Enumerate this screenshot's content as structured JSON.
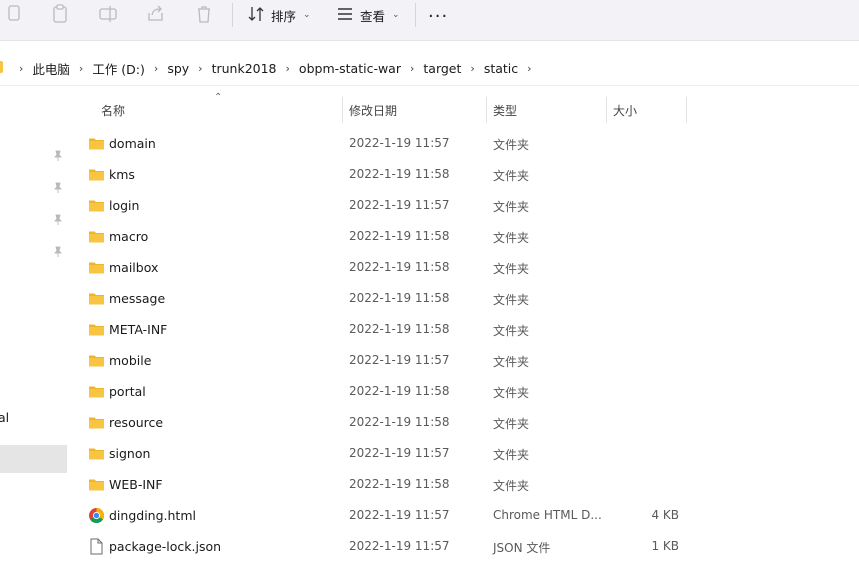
{
  "toolbar": {
    "sort_label": "排序",
    "view_label": "查看",
    "more_label": "···"
  },
  "breadcrumb": [
    "此电脑",
    "工作 (D:)",
    "spy",
    "trunk2018",
    "obpm-static-war",
    "target",
    "static"
  ],
  "sidebar": {
    "partial_label": "al"
  },
  "columns": {
    "name": "名称",
    "date": "修改日期",
    "type": "类型",
    "size": "大小"
  },
  "files": [
    {
      "name": "domain",
      "date": "2022-1-19 11:57",
      "type": "文件夹",
      "size": "",
      "icon": "folder-icon"
    },
    {
      "name": "kms",
      "date": "2022-1-19 11:58",
      "type": "文件夹",
      "size": "",
      "icon": "folder-icon"
    },
    {
      "name": "login",
      "date": "2022-1-19 11:57",
      "type": "文件夹",
      "size": "",
      "icon": "folder-icon"
    },
    {
      "name": "macro",
      "date": "2022-1-19 11:58",
      "type": "文件夹",
      "size": "",
      "icon": "folder-icon"
    },
    {
      "name": "mailbox",
      "date": "2022-1-19 11:58",
      "type": "文件夹",
      "size": "",
      "icon": "folder-icon"
    },
    {
      "name": "message",
      "date": "2022-1-19 11:58",
      "type": "文件夹",
      "size": "",
      "icon": "folder-icon"
    },
    {
      "name": "META-INF",
      "date": "2022-1-19 11:58",
      "type": "文件夹",
      "size": "",
      "icon": "folder-icon"
    },
    {
      "name": "mobile",
      "date": "2022-1-19 11:57",
      "type": "文件夹",
      "size": "",
      "icon": "folder-icon"
    },
    {
      "name": "portal",
      "date": "2022-1-19 11:58",
      "type": "文件夹",
      "size": "",
      "icon": "folder-icon"
    },
    {
      "name": "resource",
      "date": "2022-1-19 11:58",
      "type": "文件夹",
      "size": "",
      "icon": "folder-icon"
    },
    {
      "name": "signon",
      "date": "2022-1-19 11:57",
      "type": "文件夹",
      "size": "",
      "icon": "folder-icon"
    },
    {
      "name": "WEB-INF",
      "date": "2022-1-19 11:58",
      "type": "文件夹",
      "size": "",
      "icon": "folder-icon"
    },
    {
      "name": "dingding.html",
      "date": "2022-1-19 11:57",
      "type": "Chrome HTML D...",
      "size": "4 KB",
      "icon": "chrome-icon"
    },
    {
      "name": "package-lock.json",
      "date": "2022-1-19 11:57",
      "type": "JSON 文件",
      "size": "1 KB",
      "icon": "file-icon"
    }
  ],
  "colors": {
    "folder": "#f8c542",
    "toolbar_bg": "#f3f2f7",
    "selected_bg": "#e5e5e5"
  }
}
